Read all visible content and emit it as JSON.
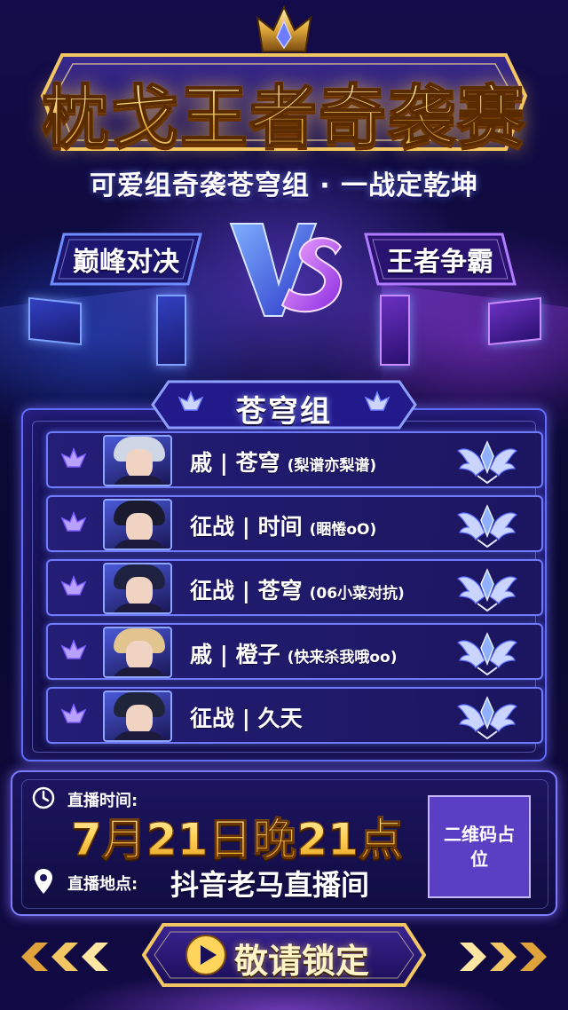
{
  "poster": {
    "title": "枕戈王者奇袭赛",
    "subtitle": "可爱组奇袭苍穹组 · 一战定乾坤",
    "vs": {
      "left_label": "巅峰对决",
      "right_label": "王者争霸"
    }
  },
  "group": {
    "name": "苍穹组",
    "players": [
      {
        "tag": "戚",
        "name": "苍穹",
        "nickname": "(梨谱亦梨谱)",
        "hair_color": "#cfd6e6"
      },
      {
        "tag": "征战",
        "name": "时间",
        "nickname": "(睏惓oO)",
        "hair_color": "#1a1a2e"
      },
      {
        "tag": "征战",
        "name": "苍穹",
        "nickname": "(06小菜对抗)",
        "hair_color": "#1e2240"
      },
      {
        "tag": "戚",
        "name": "橙子",
        "nickname": "(快来杀我哦oo)",
        "hair_color": "#e2c48f"
      },
      {
        "tag": "征战",
        "name": "久天",
        "nickname": "",
        "hair_color": "#20243a"
      }
    ],
    "separator": "|"
  },
  "broadcast": {
    "time_label": "直播时间:",
    "time_value": "7月21日晚21点",
    "place_label": "直播地点:",
    "place_value": "抖音老马直播间",
    "qr_placeholder": "二维码占位"
  },
  "cta": {
    "label": "敬请锁定"
  },
  "icons": {
    "crown": "crown-icon",
    "vs": "vs-emblem-icon",
    "team": "team-emblem-icon",
    "rank": "rank-wings-badge-icon",
    "clock": "clock-icon",
    "pin": "location-pin-icon",
    "play": "play-icon"
  },
  "colors": {
    "accent_gold": "#ffd45a",
    "accent_blue": "#5d6cff",
    "accent_purple": "#a45cff",
    "qr_bg": "#5a3fc4"
  }
}
